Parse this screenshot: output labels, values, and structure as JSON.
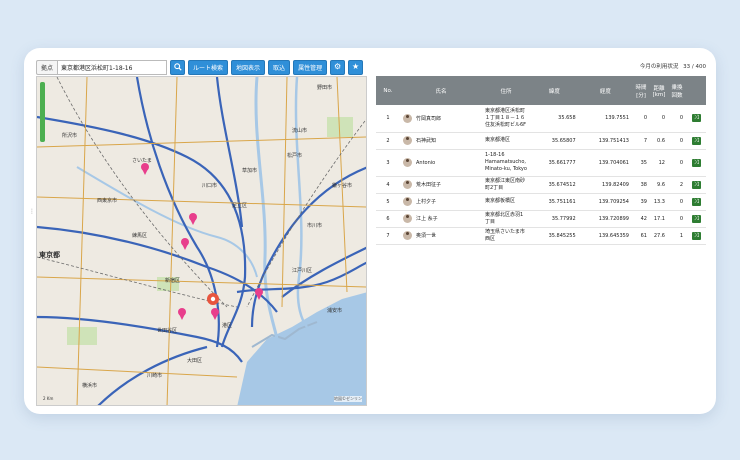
{
  "toolbar": {
    "base_label": "拠点",
    "address_value": "東京都港区浜松町1-18-16",
    "search_icon": "search-icon",
    "route_button": "ルート検索",
    "map_view_button": "地図表示",
    "import_button": "取込",
    "attr_edit_button": "属性管理",
    "settings_icon": "gear-icon",
    "favorite_icon": "star-icon"
  },
  "usage": {
    "label": "今月の利用状況",
    "count": "33 / 400"
  },
  "map": {
    "scale_label": "2 Km",
    "copyright": "地図©ゼンリン",
    "labels": [
      "さいたま",
      "川口市",
      "足立区",
      "練馬区",
      "新宿区",
      "世田谷区",
      "東京都",
      "川崎市",
      "横浜市",
      "港区",
      "市川市",
      "松戸市",
      "流山市",
      "草加市",
      "江戸川区",
      "大田区",
      "浦安市",
      "鎌ヶ谷市",
      "所沢市",
      "西東京市",
      "野田市"
    ],
    "colors": {
      "water": "#a7c8e6",
      "land": "#eeeae2",
      "road": "#3a64b8",
      "marker": "#e83e8c",
      "origin": "#e8553e"
    }
  },
  "table": {
    "headers": [
      "No.",
      "氏名",
      "住所",
      "緯度",
      "経度",
      "時間[分]",
      "距離[km]",
      "乗換回数",
      ""
    ],
    "rows": [
      {
        "no": "1",
        "name": "竹岡真司郎",
        "address": "東京都港区浜松町１丁目１８－１６ 住友浜松町ビル6F",
        "lat": "35.658",
        "lng": "139.7551",
        "time": "0",
        "dist": "0",
        "transfers": "0"
      },
      {
        "no": "2",
        "name": "石神武知",
        "address": "東京都港区",
        "lat": "35.65807",
        "lng": "139.751413",
        "time": "7",
        "dist": "0.6",
        "transfers": "0"
      },
      {
        "no": "3",
        "name": "Antonio",
        "address": "1-18-16 Hamamatsucho, Minato-ku, Tokyo",
        "lat": "35.661777",
        "lng": "139.704061",
        "time": "35",
        "dist": "12",
        "transfers": "0"
      },
      {
        "no": "4",
        "name": "荒木田征子",
        "address": "東京都江東区南砂町2丁目",
        "lat": "35.674512",
        "lng": "139.82409",
        "time": "38",
        "dist": "9.6",
        "transfers": "2"
      },
      {
        "no": "5",
        "name": "上村夕子",
        "address": "東京都板橋区",
        "lat": "35.751161",
        "lng": "139.709254",
        "time": "39",
        "dist": "13.3",
        "transfers": "0"
      },
      {
        "no": "6",
        "name": "江上 糸子",
        "address": "東京都北区赤羽1丁目",
        "lat": "35.77992",
        "lng": "139.720899",
        "time": "42",
        "dist": "17.1",
        "transfers": "0"
      },
      {
        "no": "7",
        "name": "奥須一世",
        "address": "埼玉県さいたま市西区",
        "lat": "35.845255",
        "lng": "139.645359",
        "time": "61",
        "dist": "27.6",
        "transfers": "1"
      }
    ],
    "action_icon": "shuffle-icon"
  }
}
